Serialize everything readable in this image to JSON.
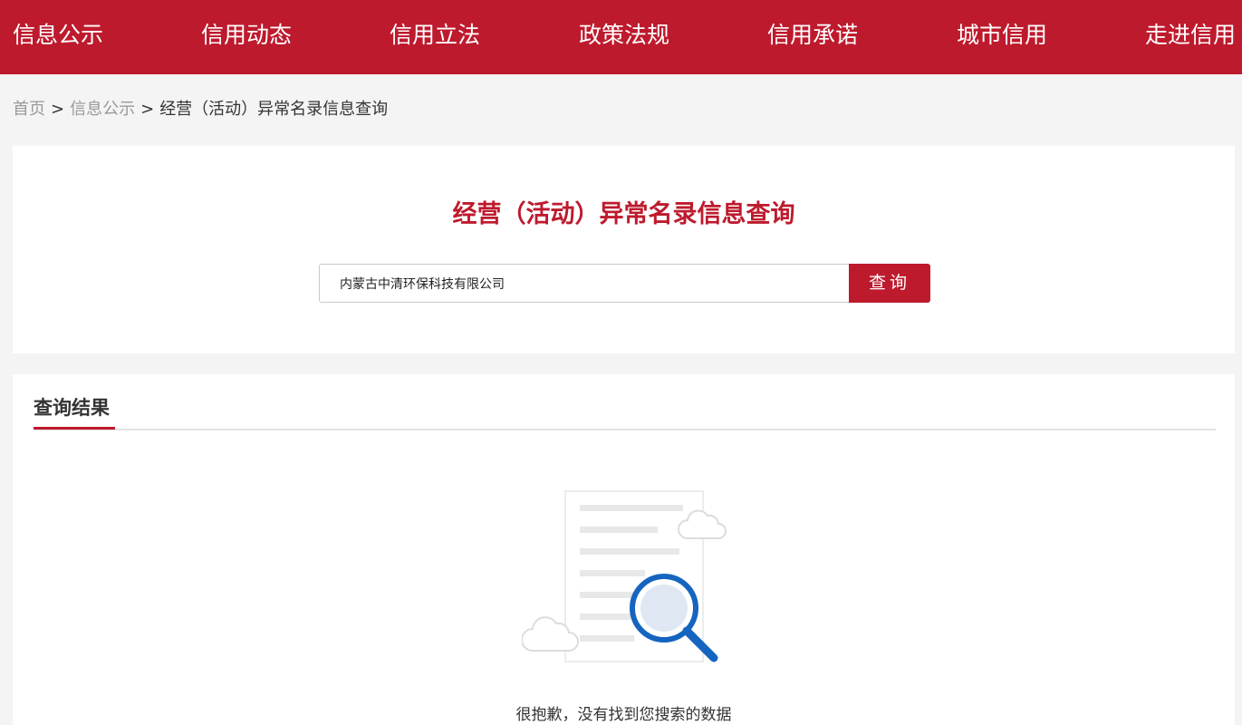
{
  "nav": {
    "items": [
      "信息公示",
      "信用动态",
      "信用立法",
      "政策法规",
      "信用承诺",
      "城市信用",
      "走进信用"
    ]
  },
  "breadcrumb": {
    "home": "首页",
    "section": "信息公示",
    "current": "经营（活动）异常名录信息查询",
    "separator": ">"
  },
  "search": {
    "title": "经营（活动）异常名录信息查询",
    "input_value": "内蒙古中清环保科技有限公司",
    "button_label": "查询"
  },
  "results": {
    "tab_label": "查询结果",
    "empty_message": "很抱歉，没有找到您搜索的数据"
  },
  "colors": {
    "brand_red": "#be1a2d",
    "page_background": "#f4f4f4",
    "magnifier_blue": "#1565c0"
  },
  "icons": {
    "empty_state": "document-search-icon"
  }
}
